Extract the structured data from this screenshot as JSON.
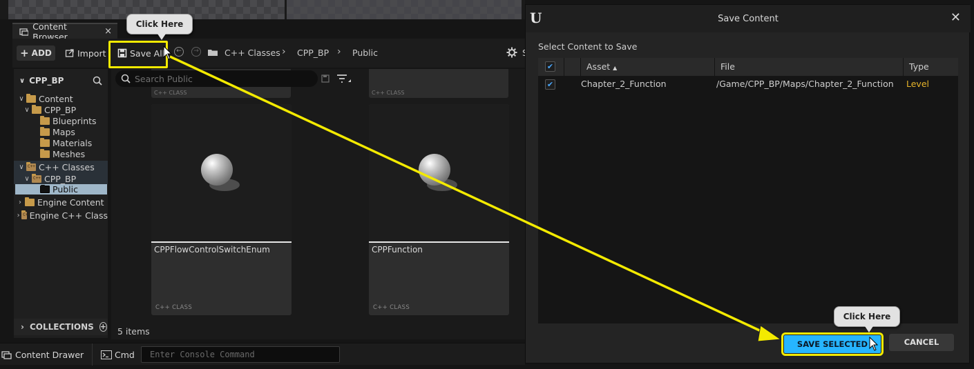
{
  "tab": {
    "title": "Content Browser",
    "close": "×"
  },
  "toolbar": {
    "add_label": "ADD",
    "import_label": "Import",
    "save_all_label": "Save All",
    "breadcrumbs": [
      "C++ Classes",
      "CPP_BP",
      "Public"
    ],
    "settings_partial": "S"
  },
  "sidebar": {
    "header": "CPP_BP",
    "tree": [
      {
        "label": "Content"
      },
      {
        "label": "CPP_BP"
      },
      {
        "label": "Blueprints"
      },
      {
        "label": "Maps"
      },
      {
        "label": "Materials"
      },
      {
        "label": "Meshes"
      },
      {
        "label": "C++ Classes"
      },
      {
        "label": "CPP_BP"
      },
      {
        "label": "Public"
      },
      {
        "label": "Engine Content"
      },
      {
        "label": "Engine C++ Class"
      }
    ],
    "collections": "COLLECTIONS"
  },
  "content": {
    "search_placeholder": "Search Public",
    "ghost_kind": "C++ CLASS",
    "cards": [
      {
        "name": "CPPFlowControlSwitchEnum",
        "kind": "C++ CLASS"
      },
      {
        "name": "CPPFunction",
        "kind": "C++ CLASS"
      }
    ],
    "item_count": "5 items"
  },
  "bottombar": {
    "drawer_label": "Content Drawer",
    "cmd_label": "Cmd",
    "console_placeholder": "Enter Console Command"
  },
  "dialog": {
    "title": "Save Content",
    "subtitle": "Select Content to Save",
    "columns": {
      "asset": "Asset",
      "file": "File",
      "type": "Type"
    },
    "rows": [
      {
        "asset": "Chapter_2_Function",
        "file": "/Game/CPP_BP/Maps/Chapter_2_Function",
        "type": "Level",
        "checked": true
      }
    ],
    "save_selected": "SAVE SELECTED",
    "cancel": "CANCEL"
  },
  "annotations": {
    "callout_1": "Click Here",
    "callout_2": "Click Here",
    "highlight_color": "#f3ea00"
  },
  "colors": {
    "accent": "#26b5ff",
    "level_type": "#e8b52a"
  }
}
